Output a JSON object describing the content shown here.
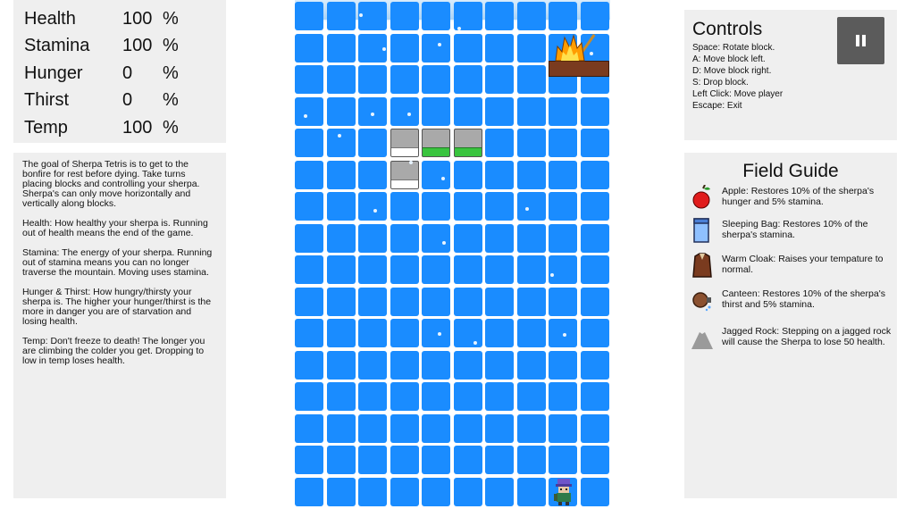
{
  "stats": [
    {
      "name": "Health",
      "value": "100",
      "unit": "%"
    },
    {
      "name": "Stamina",
      "value": "100",
      "unit": "%"
    },
    {
      "name": "Hunger",
      "value": "0",
      "unit": "%"
    },
    {
      "name": "Thirst",
      "value": "0",
      "unit": "%"
    },
    {
      "name": "Temp",
      "value": "100",
      "unit": "%"
    }
  ],
  "info": [
    "The goal of Sherpa Tetris is to get to the bonfire for rest before dying. Take turns placing blocks and controlling your sherpa. Sherpa's can only move horizontally and vertically along blocks.",
    "Health: How healthy your sherpa is. Running out of health means the end of the game.",
    "Stamina: The energy of your sherpa. Running out of stamina means you can no longer traverse the mountain. Moving uses stamina.",
    "Hunger & Thirst: How hungry/thirsty your sherpa is. The higher your hunger/thirst is the more in danger you are of starvation and losing health.",
    "Temp: Don't freeze to death! The longer you are climbing the colder you get. Dropping to low in temp loses health."
  ],
  "controls": {
    "title": "Controls",
    "lines": [
      "Space: Rotate block.",
      "A:  Move block left.",
      "D:  Move block right.",
      "S:  Drop block.",
      "Left Click: Move player",
      "Escape: Exit"
    ]
  },
  "guide": {
    "title": "Field Guide",
    "entries": [
      {
        "icon": "apple-icon",
        "text": "Apple: Restores 10% of the sherpa's hunger and 5% stamina."
      },
      {
        "icon": "sleeping-bag-icon",
        "text": "Sleeping Bag: Restores 10% of the sherpa's stamina."
      },
      {
        "icon": "warm-cloak-icon",
        "text": "Warm Cloak: Raises your tempature to normal."
      },
      {
        "icon": "canteen-icon",
        "text": "Canteen: Restores 10% of the sherpa's thirst and 5% stamina."
      },
      {
        "icon": "jagged-rock-icon",
        "text": "Jagged Rock: Stepping on a jagged rock will cause the Sherpa to lose 50 health."
      }
    ]
  },
  "board": {
    "columns": 10,
    "rows": 16,
    "colors": {
      "ice": "#1a8cff",
      "rock": "#a9a9a9",
      "grass": "#39c43e",
      "snow": "#ffffff"
    },
    "blocks": [
      {
        "col": 3,
        "row": 4,
        "type": "snow"
      },
      {
        "col": 4,
        "row": 4,
        "type": "grass"
      },
      {
        "col": 5,
        "row": 4,
        "type": "grass"
      },
      {
        "col": 3,
        "row": 5,
        "type": "snow"
      }
    ],
    "bonfire": {
      "col": 8,
      "row": 1
    },
    "sherpa": {
      "col": 8,
      "row": 15
    }
  }
}
